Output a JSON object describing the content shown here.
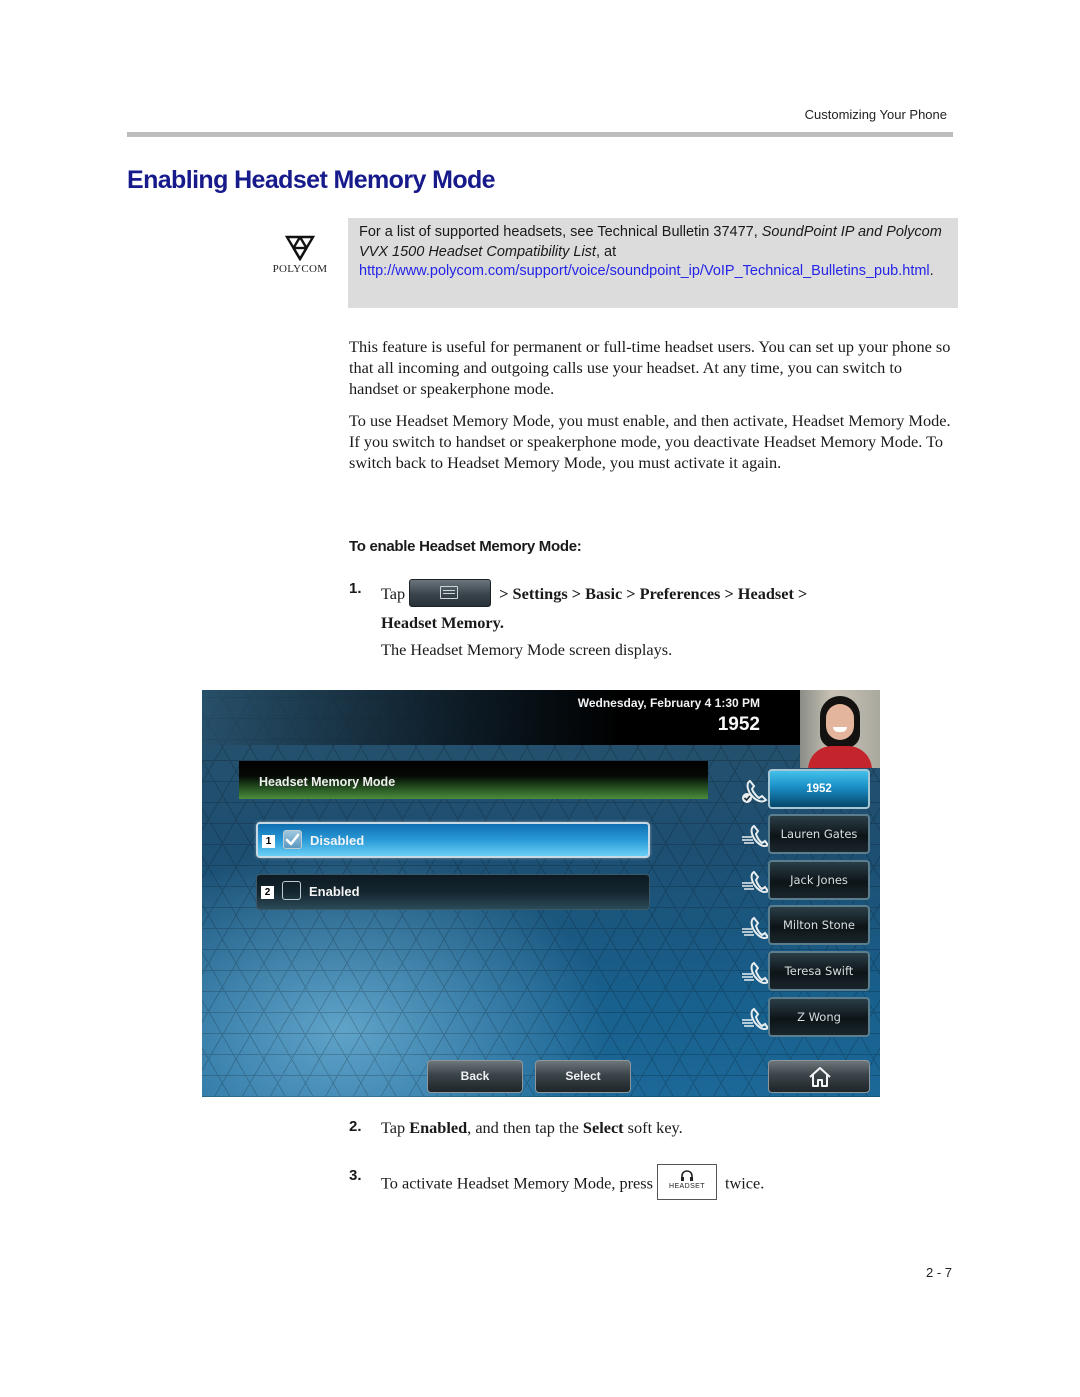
{
  "header": {
    "running_head": "Customizing Your Phone",
    "page_number": "2 - 7"
  },
  "section": {
    "title": "Enabling Headset Memory Mode"
  },
  "note": {
    "logo_text": "POLYCOM",
    "text_before": "For a list of supported headsets, see Technical Bulletin 37477, ",
    "italic_title": "SoundPoint IP and Polycom VVX 1500 Headset Compatibility List",
    "text_after": ", at",
    "link": "http://www.polycom.com/support/voice/soundpoint_ip/VoIP_Technical_Bulletins_pub.html",
    "link_suffix": "."
  },
  "body": {
    "paragraph_1": "This feature is useful for permanent or full-time headset users. You can set up your phone so that all incoming and outgoing calls use your headset. At any time, you can switch to handset or speakerphone mode.",
    "paragraph_2": "To use Headset Memory Mode, you must enable, and then activate, Headset Memory Mode. If you switch to handset or speakerphone mode, you deactivate Headset Memory Mode. To switch back to Headset Memory Mode, you must activate it again."
  },
  "procedure": {
    "heading": "To enable Headset Memory Mode:",
    "steps": [
      {
        "number": "1.",
        "tap": "Tap",
        "path": "> Settings > Basic > Preferences > Headset >",
        "path_end": "Headset Memory.",
        "result": "The Headset Memory Mode screen displays."
      },
      {
        "number": "2.",
        "pre": "Tap ",
        "bold_1": "Enabled",
        "mid": ", and then tap the ",
        "bold_2": "Select",
        "post": " soft key."
      },
      {
        "number": "3.",
        "pre": "To activate Headset Memory Mode, press",
        "key_label": "HEADSET",
        "post": "twice."
      }
    ]
  },
  "phone_screen": {
    "datetime": "Wednesday, February 4  1:30 PM",
    "extension": "1952",
    "screen_title": "Headset Memory Mode",
    "options": [
      {
        "index": "1",
        "label": "Disabled",
        "checked": true,
        "selected": true
      },
      {
        "index": "2",
        "label": "Enabled",
        "checked": false,
        "selected": false
      }
    ],
    "line_keys": [
      {
        "label": "1952",
        "active": true
      },
      {
        "label": "Lauren Gates",
        "active": false
      },
      {
        "label": "Jack Jones",
        "active": false
      },
      {
        "label": "Milton Stone",
        "active": false
      },
      {
        "label": "Teresa Swift",
        "active": false
      },
      {
        "label": "Z Wong",
        "active": false
      }
    ],
    "soft_keys": [
      "Back",
      "Select"
    ],
    "home_icon": "home-icon"
  }
}
